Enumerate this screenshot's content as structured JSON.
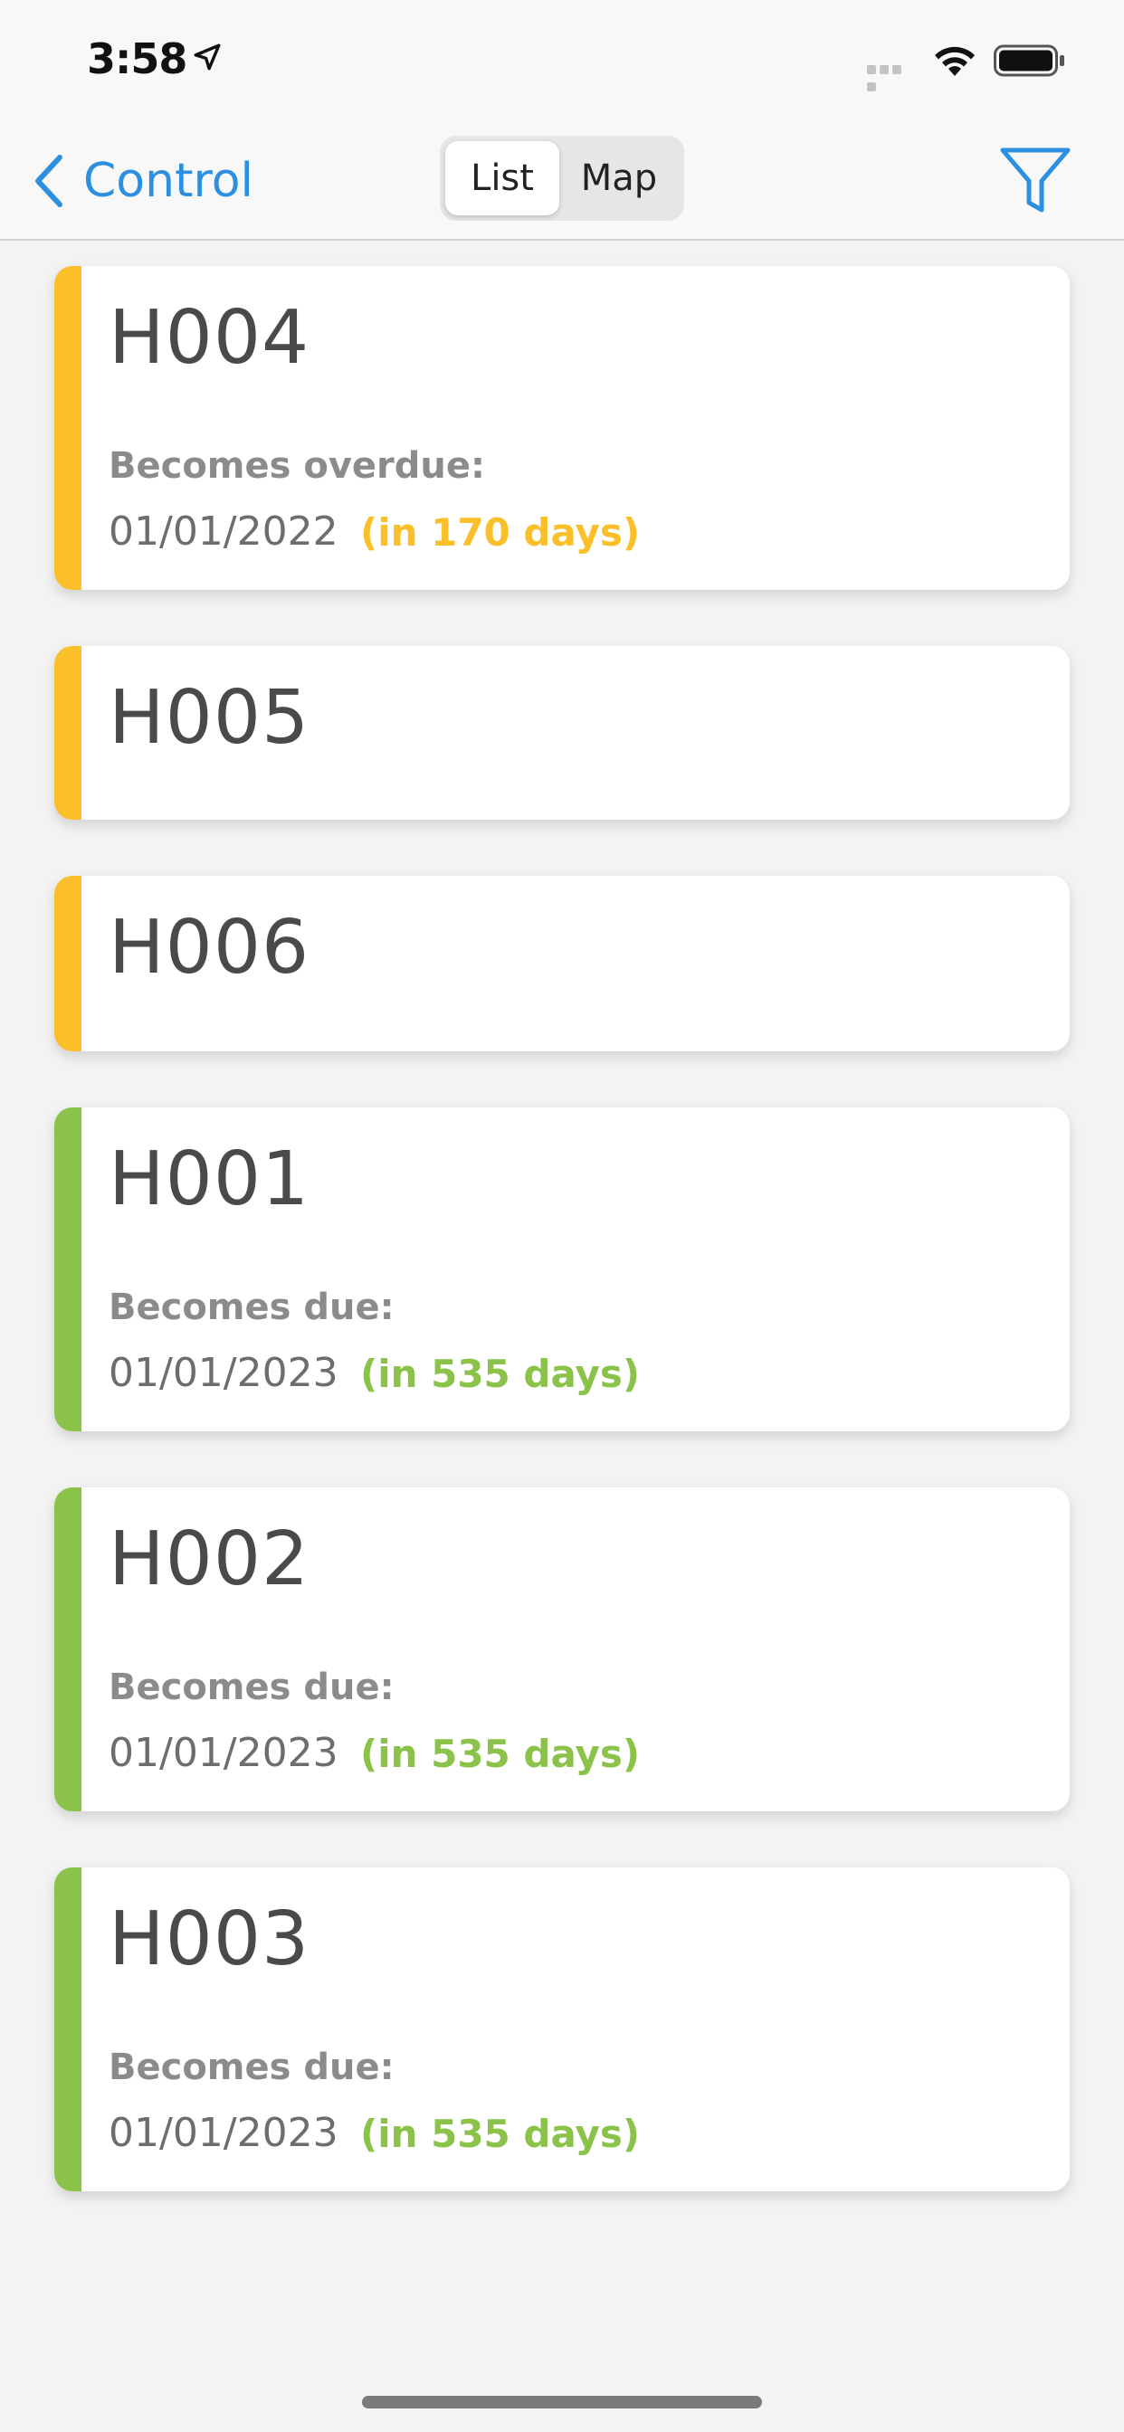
{
  "status": {
    "time": "3:58"
  },
  "nav": {
    "back_label": "Control",
    "segments": {
      "list": "List",
      "map": "Map"
    }
  },
  "colors": {
    "accent": "#2d8fe0",
    "warning": "#fbbf2a",
    "ok": "#8bc34a"
  },
  "cards": [
    {
      "title": "H004",
      "label": "Becomes overdue:",
      "date": "01/01/2022",
      "relative": "(in 170 days)",
      "status": "warning"
    },
    {
      "title": "H005",
      "status": "warning"
    },
    {
      "title": "H006",
      "status": "warning"
    },
    {
      "title": "H001",
      "label": "Becomes due:",
      "date": "01/01/2023",
      "relative": "(in 535 days)",
      "status": "ok"
    },
    {
      "title": "H002",
      "label": "Becomes due:",
      "date": "01/01/2023",
      "relative": "(in 535 days)",
      "status": "ok"
    },
    {
      "title": "H003",
      "label": "Becomes due:",
      "date": "01/01/2023",
      "relative": "(in 535 days)",
      "status": "ok"
    }
  ]
}
